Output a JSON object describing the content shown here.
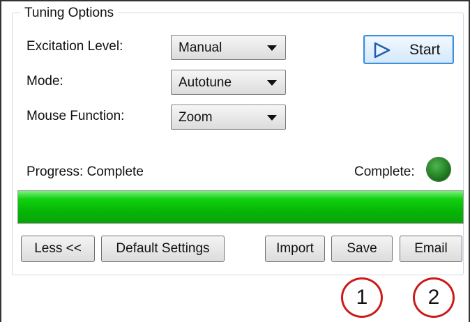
{
  "group": {
    "title": "Tuning Options"
  },
  "fields": {
    "excitation": {
      "label": "Excitation Level:",
      "value": "Manual"
    },
    "mode": {
      "label": "Mode:",
      "value": "Autotune"
    },
    "mouse": {
      "label": "Mouse Function:",
      "value": "Zoom"
    }
  },
  "start": {
    "label": "Start"
  },
  "progress": {
    "text": "Progress: Complete",
    "status_label": "Complete:",
    "fraction": 1.0,
    "bar_color": "#12d012",
    "led_color": "#1f7a1f"
  },
  "buttons": {
    "less": "Less <<",
    "defaults": "Default Settings",
    "import": "Import",
    "save": "Save",
    "email": "Email"
  },
  "annotations": {
    "one": "1",
    "two": "2"
  },
  "colors": {
    "accent": "#3c8fd8",
    "annotation": "#cc1a1a"
  },
  "icons": {
    "start": "play-icon",
    "combo": "chevron-down-icon",
    "status": "status-led-icon"
  }
}
